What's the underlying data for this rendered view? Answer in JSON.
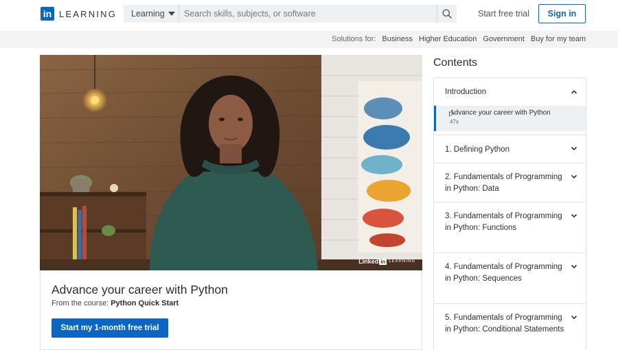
{
  "header": {
    "logo_text": "LEARNING",
    "logo_mark": "in",
    "search_category": "Learning",
    "search_placeholder": "Search skills, subjects, or software",
    "free_trial_link": "Start free trial",
    "signin_label": "Sign in"
  },
  "subnav": {
    "label": "Solutions for:",
    "links": [
      "Business",
      "Higher Education",
      "Government",
      "Buy for my team"
    ]
  },
  "video": {
    "watermark": "Linked",
    "watermark_mark": "in",
    "watermark_suffix": "LEARNING"
  },
  "course": {
    "title": "Advance your career with Python",
    "from_label": "From the course:",
    "course_name": "Python Quick Start",
    "cta_label": "Start my 1-month free trial"
  },
  "contents": {
    "heading": "Contents",
    "introduction": {
      "label": "Introduction",
      "expanded": true,
      "sub_item": {
        "title": "Advance your career with Python",
        "duration": "47s"
      }
    },
    "chapters": [
      "1. Defining Python",
      "2. Fundamentals of Programming in Python: Data",
      "3. Fundamentals of Programming in Python: Functions",
      "4. Fundamentals of Programming in Python: Sequences",
      "5. Fundamentals of Programming in Python: Conditional Statements"
    ]
  },
  "colors": {
    "brand_blue": "#0a66c2",
    "subnav_bg": "#f1f3f5",
    "search_bg": "#eef1f4"
  },
  "icons": [
    "linkedin-logo-icon",
    "caret-down-icon",
    "search-icon",
    "chevron-up-icon",
    "chevron-down-icon",
    "play-icon"
  ]
}
